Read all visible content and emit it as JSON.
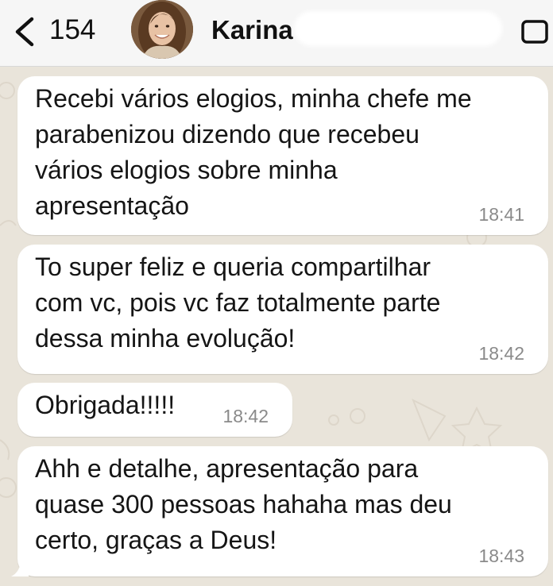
{
  "header": {
    "back_count": "154",
    "contact_name": "Karina"
  },
  "messages": [
    {
      "text": "Recebi vários elogios, minha chefe me\nparabenizou dizendo que recebeu\nvários elogios sobre minha\napresentação",
      "time": "18:41"
    },
    {
      "text": "To super feliz e queria compartilhar\ncom vc, pois vc faz totalmente parte\ndessa minha evolução!",
      "time": "18:42"
    },
    {
      "text": "Obrigada!!!!!",
      "time": "18:42"
    },
    {
      "text": "Ahh e detalhe, apresentação para\nquase 300 pessoas hahaha mas deu\ncerto, graças a Deus!",
      "time": "18:43"
    }
  ],
  "colors": {
    "chat_background": "#e9e4da",
    "bubble": "#ffffff",
    "header": "#f6f6f6"
  },
  "icons": [
    "chevron-left-icon",
    "video-call-icon"
  ]
}
